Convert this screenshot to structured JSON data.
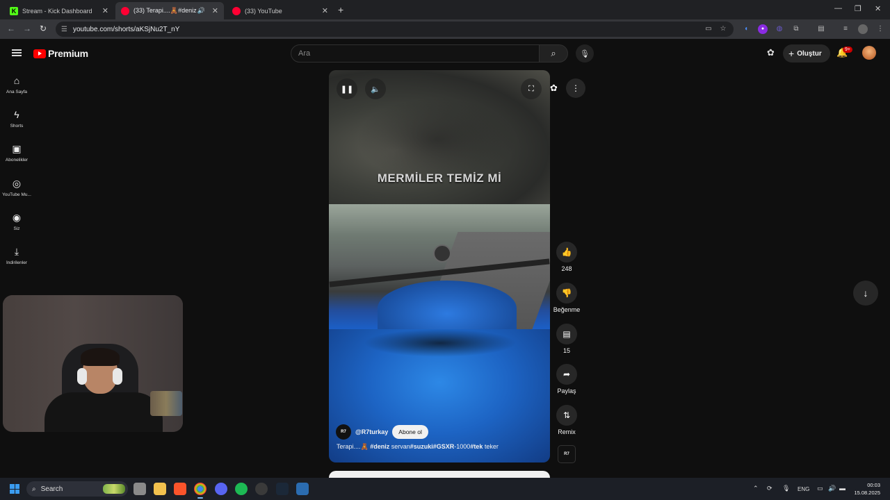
{
  "browser": {
    "tabs": [
      {
        "title": "Stream - Kick Dashboard",
        "favicon_color": "#53fc18",
        "active": false
      },
      {
        "title": "(33) Terapi....🧸#deniz servan",
        "favicon_color": "#ff0033",
        "active": true
      },
      {
        "title": "(33) YouTube",
        "favicon_color": "#ff0033",
        "active": false
      }
    ],
    "url": "youtube.com/shorts/aKSjNu2T_nY"
  },
  "header": {
    "logo_text": "Premium",
    "search_placeholder": "Ara",
    "create_label": "Oluştur",
    "notifications_badge": "9+"
  },
  "sidebar": {
    "items": [
      {
        "label": "Ana Sayfa",
        "icon": "home-icon"
      },
      {
        "label": "Shorts",
        "icon": "shorts-icon"
      },
      {
        "label": "Abonelikler",
        "icon": "subscriptions-icon"
      },
      {
        "label": "YouTube Mu...",
        "icon": "youtube-music-icon"
      },
      {
        "label": "Siz",
        "icon": "you-icon"
      },
      {
        "label": "İndirilenler",
        "icon": "download-icon"
      }
    ]
  },
  "short": {
    "overlay_text": "MERMİLER TEMİZ Mİ",
    "channel_avatar_text": "R7",
    "channel_name": "@R7turkay",
    "subscribe_label": "Abone ol",
    "caption_parts": [
      {
        "text": "Terapi....🧸 ",
        "bold": false
      },
      {
        "text": "#deniz",
        "bold": true
      },
      {
        "text": " servan",
        "bold": false
      },
      {
        "text": "#suzuki",
        "bold": true
      },
      {
        "text": "#GSXR",
        "bold": true
      },
      {
        "text": "-1000",
        "bold": false
      },
      {
        "text": "#tek",
        "bold": true
      },
      {
        "text": " teker",
        "bold": false
      }
    ],
    "likes": "248",
    "dislike_label": "Beğenme",
    "comments": "15",
    "share_label": "Paylaş",
    "remix_label": "Remix",
    "sound_thumb_text": "R7"
  },
  "taskbar": {
    "search_label": "Search",
    "language": "ENG",
    "time": "00:03",
    "date": "15.08.2025"
  }
}
